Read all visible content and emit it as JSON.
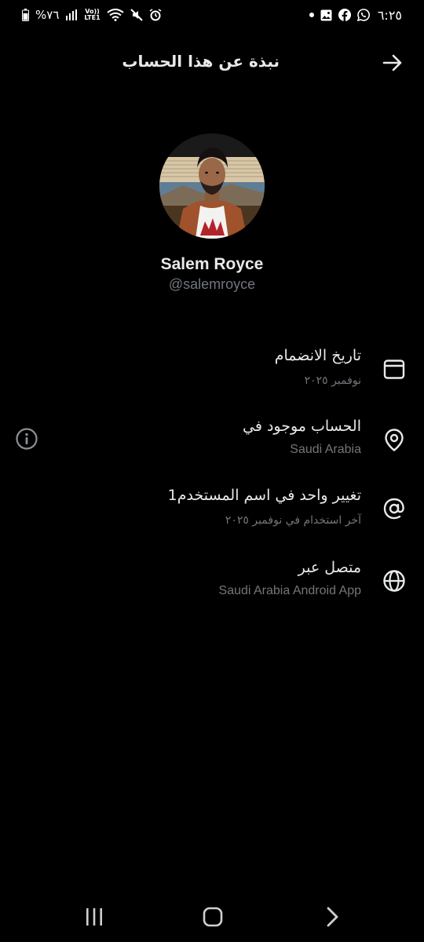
{
  "status_bar": {
    "battery_percent": "%٧٦",
    "network_top": "Vo))",
    "network_bottom": "LTE1",
    "time": "٦:٢٥"
  },
  "header": {
    "title": "نبذة عن هذا الحساب"
  },
  "profile": {
    "name": "Salem Royce",
    "handle": "@salemroyce"
  },
  "rows": [
    {
      "icon": "calendar-icon",
      "title": "تاريخ الانضمام",
      "sub": "نوفمبر ٢٠٢٥"
    },
    {
      "icon": "location-pin-icon",
      "title": "الحساب موجود في",
      "sub": "Saudi Arabia"
    },
    {
      "icon": "at-sign-icon",
      "title": "تغيير واحد في اسم المستخدم1",
      "sub": "آخر استخدام في نوفمبر ٢٠٢٥"
    },
    {
      "icon": "globe-icon",
      "title": "متصل عبر",
      "sub": "Saudi Arabia Android App"
    }
  ],
  "colors": {
    "background": "#000000",
    "primary_text": "#e7e9ea",
    "secondary_text": "#71767b"
  }
}
